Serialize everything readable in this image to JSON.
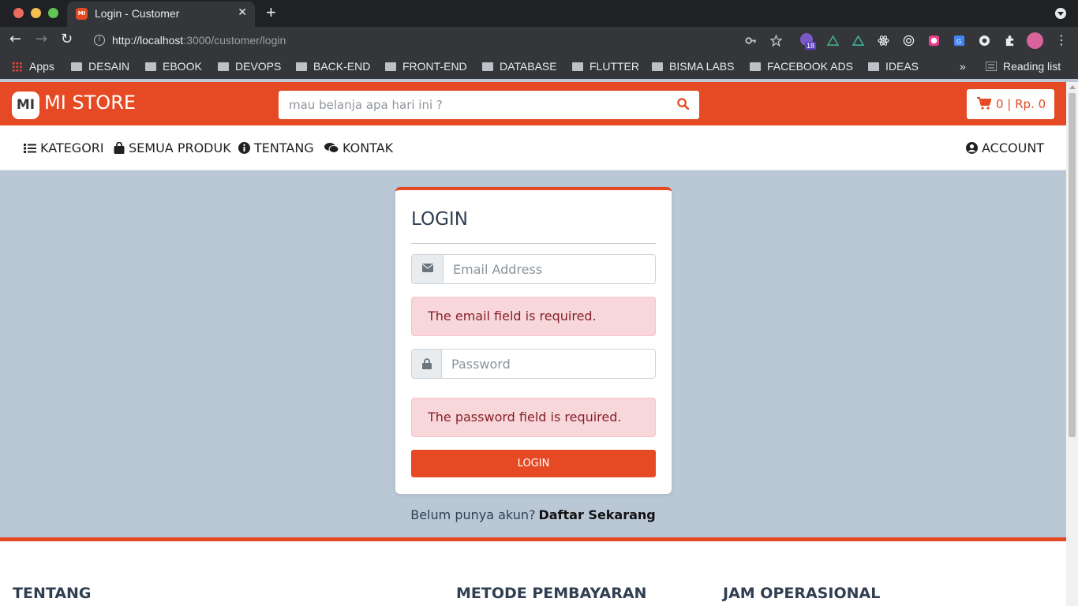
{
  "browser": {
    "tab_title": "Login - Customer",
    "tab_favicon": "MI",
    "url_host": "http://localhost",
    "url_rest": ":3000/customer/login",
    "extension_badge": "18",
    "bookmarks": [
      "Apps",
      "DESAIN",
      "EBOOK",
      "DEVOPS",
      "BACK-END",
      "FRONT-END",
      "DATABASE",
      "FLUTTER",
      "BISMA LABS",
      "FACEBOOK ADS",
      "IDEAS"
    ],
    "overflow": "»",
    "reading_list": "Reading list"
  },
  "header": {
    "logo_mark": "MI",
    "brand": "MI STORE",
    "search_placeholder": "mau belanja apa hari ini ?",
    "cart_text": "0 | Rp. 0",
    "accent_color": "#e54a24"
  },
  "menu": {
    "items": [
      "KATEGORI",
      "SEMUA PRODUK",
      "TENTANG",
      "KONTAK"
    ],
    "account": "ACCOUNT"
  },
  "login": {
    "title": "LOGIN",
    "email_placeholder": "Email Address",
    "email_error": "The email field is required.",
    "password_placeholder": "Password",
    "password_error": "The password field is required.",
    "button": "LOGIN"
  },
  "register": {
    "prompt": "Belum punya akun?",
    "link": "Daftar Sekarang"
  },
  "footer": {
    "headings": [
      "TENTANG",
      "METODE PEMBAYARAN",
      "JAM OPERASIONAL"
    ]
  }
}
